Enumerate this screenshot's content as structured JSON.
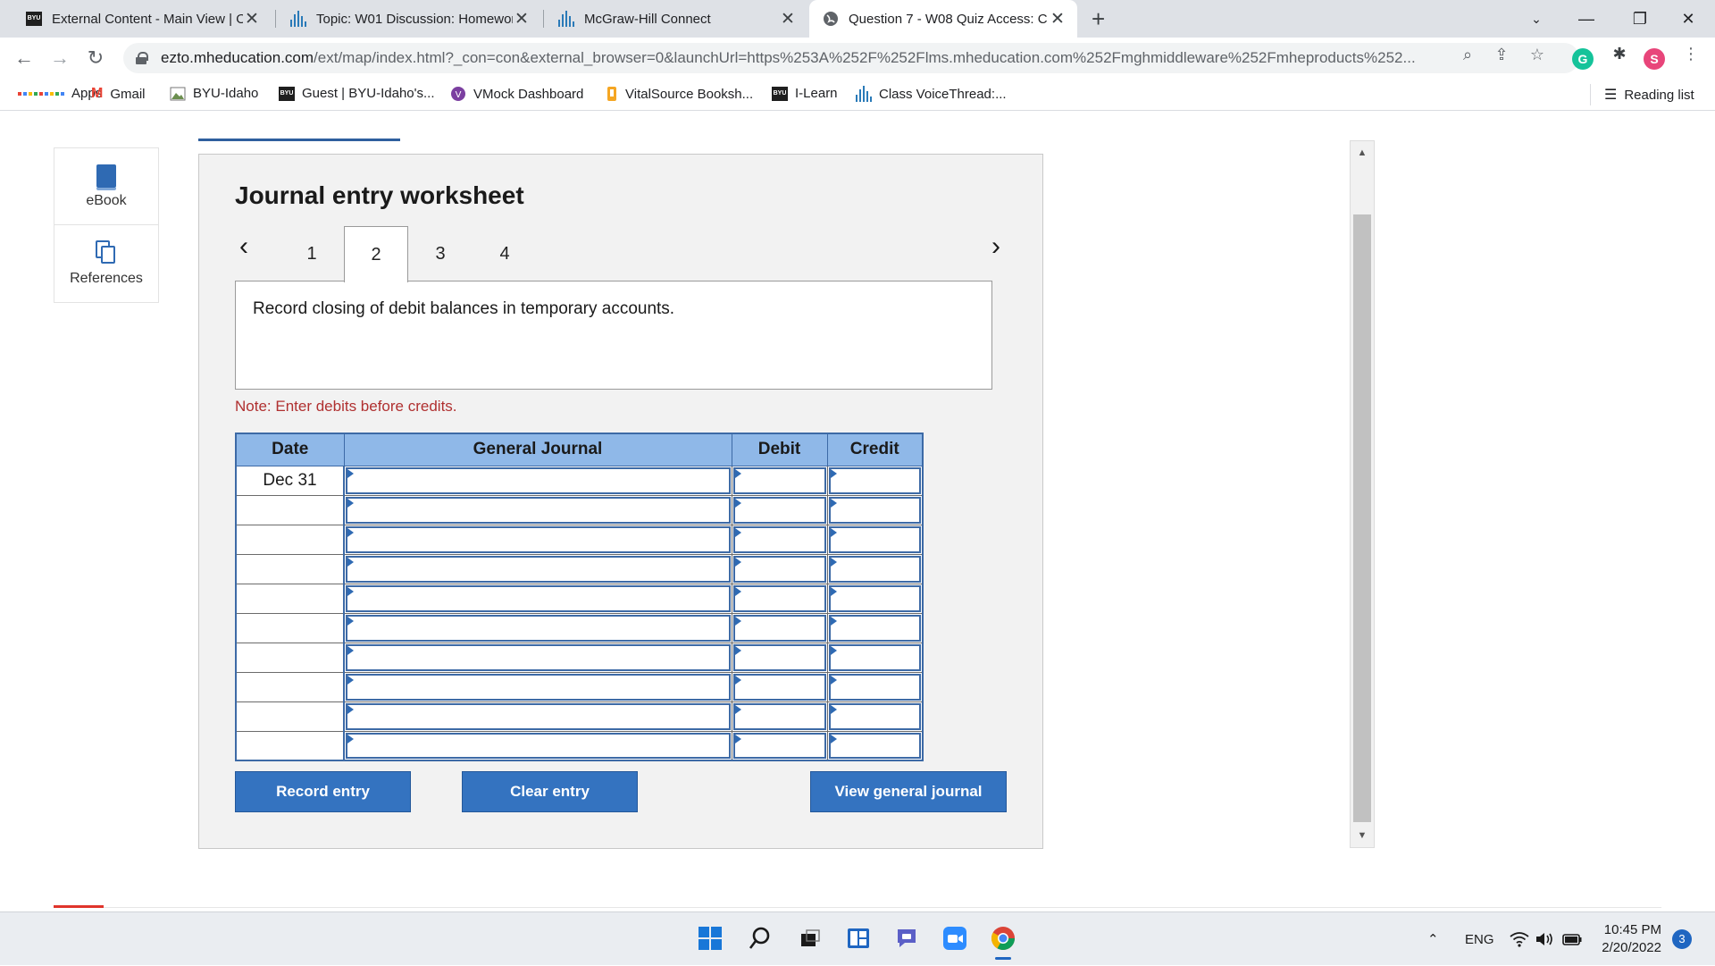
{
  "browser": {
    "tabs": [
      {
        "title": "External Content - Main View | O",
        "icon": "byu-icon",
        "active": false
      },
      {
        "title": "Topic: W01 Discussion: Homewor",
        "icon": "bar-chart-icon",
        "active": false
      },
      {
        "title": "McGraw-Hill Connect",
        "icon": "bar-chart-icon",
        "active": false
      },
      {
        "title": "Question 7 - W08 Quiz Access: C",
        "icon": "globe-icon",
        "active": true
      }
    ],
    "url_host": "ezto.mheducation.com",
    "url_rest": "/ext/map/index.html?_con=con&external_browser=0&launchUrl=https%253A%252F%252Flms.mheducation.com%252Fmghmiddleware%252Fmheproducts%252...",
    "profile_initial": "S",
    "grammarly_letter": "G"
  },
  "bookmarks": [
    {
      "label": "Apps",
      "icon": "apps-grid-icon"
    },
    {
      "label": "Gmail",
      "icon": "gmail-icon"
    },
    {
      "label": "BYU-Idaho",
      "icon": "image-icon"
    },
    {
      "label": "Guest | BYU-Idaho's...",
      "icon": "byu-icon"
    },
    {
      "label": "VMock Dashboard",
      "icon": "vmock-icon"
    },
    {
      "label": "VitalSource Booksh...",
      "icon": "vitalsource-icon"
    },
    {
      "label": "I-Learn",
      "icon": "byu-icon"
    },
    {
      "label": "Class VoiceThread:...",
      "icon": "bar-chart-icon"
    }
  ],
  "reading_list": "Reading list",
  "side": {
    "ebook": "eBook",
    "references": "References"
  },
  "worksheet": {
    "title": "Journal entry worksheet",
    "pages": [
      "1",
      "2",
      "3",
      "4"
    ],
    "active_page": "2",
    "instruction": "Record closing of debit balances in temporary accounts.",
    "note": "Note: Enter debits before credits.",
    "columns": {
      "date": "Date",
      "journal": "General Journal",
      "debit": "Debit",
      "credit": "Credit"
    },
    "rows": [
      {
        "date": "Dec 31",
        "journal": "",
        "debit": "",
        "credit": ""
      },
      {
        "date": "",
        "journal": "",
        "debit": "",
        "credit": ""
      },
      {
        "date": "",
        "journal": "",
        "debit": "",
        "credit": ""
      },
      {
        "date": "",
        "journal": "",
        "debit": "",
        "credit": ""
      },
      {
        "date": "",
        "journal": "",
        "debit": "",
        "credit": ""
      },
      {
        "date": "",
        "journal": "",
        "debit": "",
        "credit": ""
      },
      {
        "date": "",
        "journal": "",
        "debit": "",
        "credit": ""
      },
      {
        "date": "",
        "journal": "",
        "debit": "",
        "credit": ""
      },
      {
        "date": "",
        "journal": "",
        "debit": "",
        "credit": ""
      },
      {
        "date": "",
        "journal": "",
        "debit": "",
        "credit": ""
      }
    ],
    "buttons": {
      "record": "Record entry",
      "clear": "Clear entry",
      "view": "View general journal"
    }
  },
  "taskbar": {
    "language": "ENG",
    "time": "10:45 PM",
    "date": "2/20/2022",
    "notifications": "3"
  },
  "colors": {
    "accent": "#3473c0",
    "header_blue": "#8fb8e8",
    "note_red": "#b03030"
  }
}
